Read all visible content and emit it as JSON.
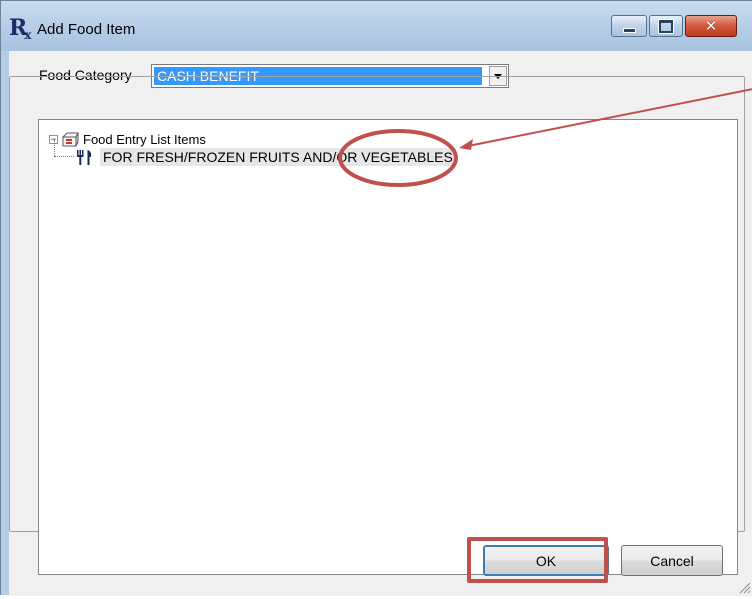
{
  "window": {
    "title": "Add Food Item",
    "icon": "rx-icon",
    "controls": [
      "minimize-icon",
      "maximize-icon",
      "close-icon"
    ]
  },
  "form": {
    "category_label": "Food Category",
    "category_value": "CASH BENEFIT"
  },
  "tree": {
    "root": {
      "label": "Food Entry List Items",
      "icon": "list-box-icon",
      "expanded": true
    },
    "items": [
      {
        "label": "FOR FRESH/FROZEN FRUITS AND/OR VEGETABLES",
        "icon": "fork-knife-icon"
      }
    ]
  },
  "buttons": {
    "ok_label": "OK",
    "cancel_label": "Cancel"
  },
  "annotation_color": "#c0504d",
  "selection_color": "#3399ff"
}
